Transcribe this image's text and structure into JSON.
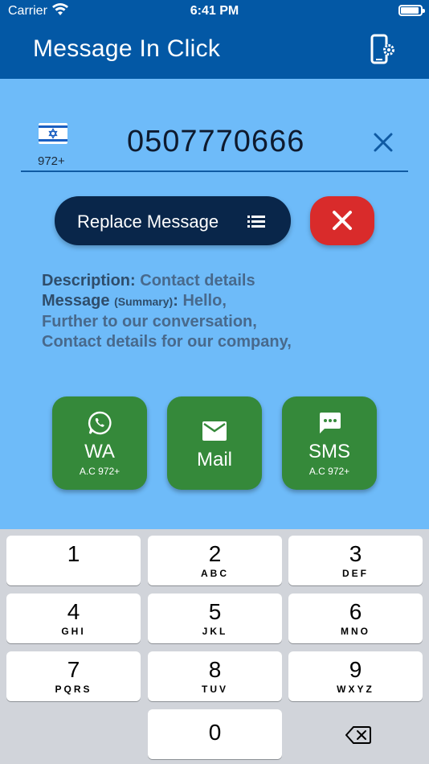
{
  "status_bar": {
    "carrier": "Carrier",
    "time": "6:41 PM",
    "battery_level": 0.9
  },
  "header": {
    "title": "Message In Click",
    "settings_icon": "phone-settings-icon"
  },
  "phone": {
    "country_flag": "israel-flag-icon",
    "prefix": "972+",
    "number": "0507770666",
    "clear_icon": "close-icon"
  },
  "actions": {
    "replace_label": "Replace Message",
    "replace_icon": "list-icon",
    "cancel_icon": "close-icon",
    "cancel_color": "#d92b2b",
    "replace_color": "#09264a"
  },
  "description": {
    "label": "Description:",
    "value": "Contact details",
    "message_label": "Message",
    "summary_tag": "(Summary)",
    "colon": ":",
    "line1": "Hello,",
    "line2": "Further to our conversation,",
    "line3": "Contact details for our company,"
  },
  "cards": [
    {
      "name": "WA",
      "sub": "A.C 972+",
      "icon": "whatsapp-icon"
    },
    {
      "name": "Mail",
      "sub": "",
      "icon": "mail-icon"
    },
    {
      "name": "SMS",
      "sub": "A.C 972+",
      "icon": "sms-icon"
    }
  ],
  "card_color": "#35893a",
  "keypad": {
    "keys": [
      {
        "digit": "1",
        "letters": ""
      },
      {
        "digit": "2",
        "letters": "ABC"
      },
      {
        "digit": "3",
        "letters": "DEF"
      },
      {
        "digit": "4",
        "letters": "GHI"
      },
      {
        "digit": "5",
        "letters": "JKL"
      },
      {
        "digit": "6",
        "letters": "MNO"
      },
      {
        "digit": "7",
        "letters": "PQRS"
      },
      {
        "digit": "8",
        "letters": "TUV"
      },
      {
        "digit": "9",
        "letters": "WXYZ"
      },
      {
        "digit": "0",
        "letters": ""
      }
    ],
    "backspace_icon": "backspace-icon"
  }
}
